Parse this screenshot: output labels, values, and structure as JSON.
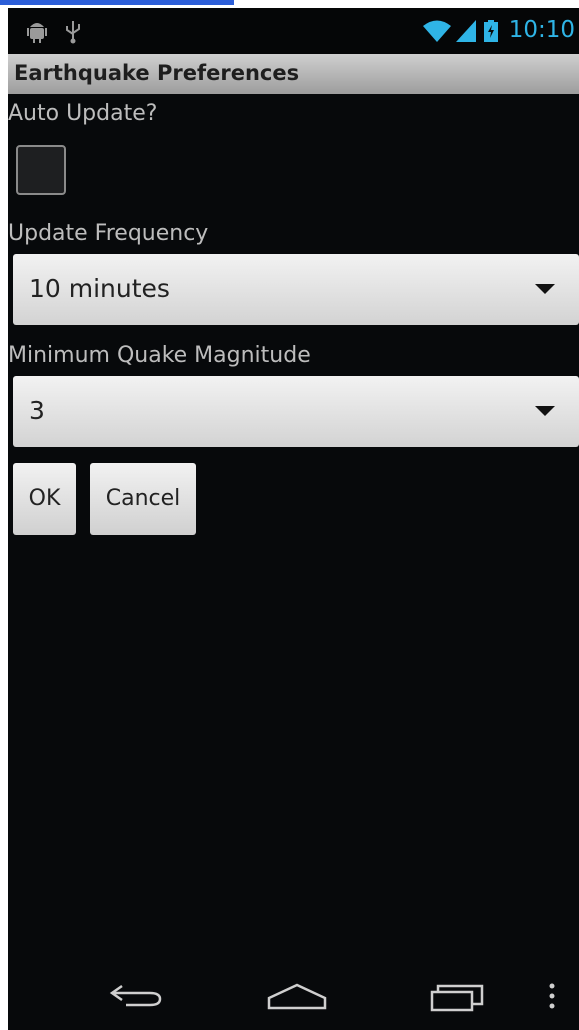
{
  "status_bar": {
    "icons": [
      "android-icon",
      "usb-icon",
      "wifi-icon",
      "signal-icon",
      "battery-icon"
    ],
    "time": "10:10",
    "accent_color": "#2fb4e6"
  },
  "title_bar": {
    "title": "Earthquake Preferences"
  },
  "preferences": {
    "auto_update": {
      "label": "Auto Update?",
      "checked": false
    },
    "update_frequency": {
      "label": "Update Frequency",
      "selected": "10 minutes"
    },
    "min_magnitude": {
      "label": "Minimum Quake Magnitude",
      "selected": "3"
    }
  },
  "buttons": {
    "ok_label": "OK",
    "cancel_label": "Cancel"
  },
  "nav_bar": {
    "icons": [
      "back-icon",
      "home-icon",
      "recent-apps-icon",
      "menu-icon"
    ]
  }
}
